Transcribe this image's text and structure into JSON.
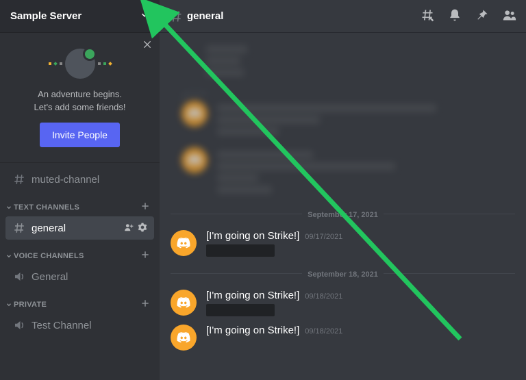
{
  "server": {
    "name": "Sample Server"
  },
  "welcome": {
    "line1": "An adventure begins.",
    "line2": "Let's add some friends!",
    "invite_label": "Invite People"
  },
  "sidebar": {
    "muted_channel": "muted-channel",
    "categories": [
      {
        "label": "TEXT CHANNELS",
        "channels": [
          {
            "name": "general",
            "type": "text",
            "active": true
          }
        ]
      },
      {
        "label": "VOICE CHANNELS",
        "channels": [
          {
            "name": "General",
            "type": "voice",
            "active": false
          }
        ]
      },
      {
        "label": "PRIVATE",
        "channels": [
          {
            "name": "Test Channel",
            "type": "voice",
            "active": false
          }
        ]
      }
    ]
  },
  "chat": {
    "channel_name": "general",
    "dividers": [
      "September 17, 2021",
      "September 18, 2021"
    ],
    "messages": [
      {
        "author": "[I'm going on Strike!]",
        "date": "09/17/2021"
      },
      {
        "author": "[I'm going on Strike!]",
        "date": "09/18/2021"
      },
      {
        "author": "[I'm going on Strike!]",
        "date": "09/18/2021"
      }
    ]
  }
}
